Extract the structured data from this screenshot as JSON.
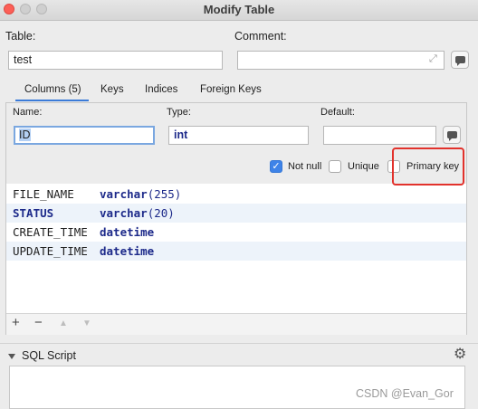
{
  "window": {
    "title": "Modify Table"
  },
  "form": {
    "table_label": "Table:",
    "table_value": "test",
    "comment_label": "Comment:",
    "comment_value": ""
  },
  "tabs": [
    {
      "label": "Columns (5)",
      "selected": true
    },
    {
      "label": "Keys"
    },
    {
      "label": "Indices"
    },
    {
      "label": "Foreign Keys"
    }
  ],
  "column_editor": {
    "name_label": "Name:",
    "name_value": "ID",
    "type_label": "Type:",
    "type_value": "int",
    "default_label": "Default:",
    "default_value": "",
    "not_null_label": "Not null",
    "not_null_checked": true,
    "unique_label": "Unique",
    "unique_checked": false,
    "primary_key_label": "Primary key",
    "primary_key_checked": false,
    "highlight_color": "#e2322c"
  },
  "columns": [
    {
      "name": "FILE_NAME",
      "type": "varchar",
      "size": "(255)"
    },
    {
      "name": "STATUS",
      "type": "varchar",
      "size": "(20)"
    },
    {
      "name": "CREATE_TIME",
      "type": "datetime",
      "size": ""
    },
    {
      "name": "UPDATE_TIME",
      "type": "datetime",
      "size": ""
    }
  ],
  "toolbar": {
    "add": "+",
    "remove": "−",
    "up": "▲",
    "down": "▼"
  },
  "sql_section": {
    "title": "SQL Script"
  },
  "watermark": "CSDN @Evan_Gor",
  "colors": {
    "accent": "#3b7bd8",
    "checkbox": "#3e83e8",
    "type_text": "#1d2a8a"
  }
}
